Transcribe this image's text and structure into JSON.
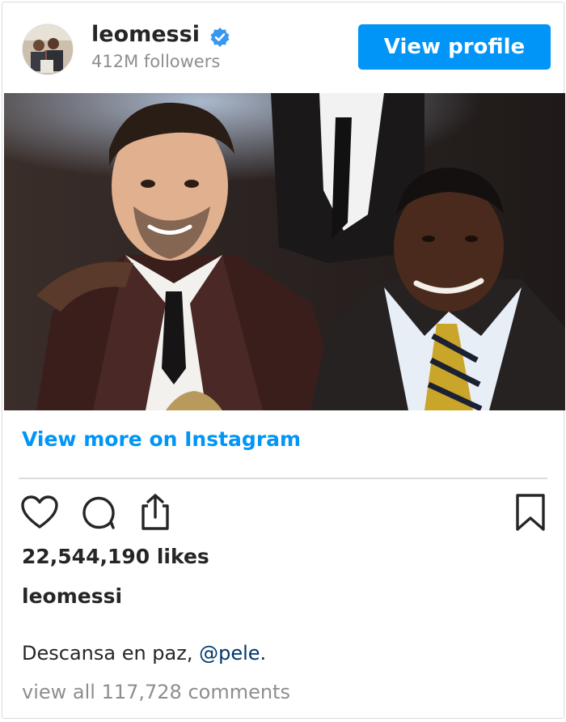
{
  "header": {
    "username": "leomessi",
    "verified_icon": "verified-badge-icon",
    "followers": "412M followers",
    "view_profile_label": "View profile"
  },
  "post": {
    "image_icon": "photo-messi-and-pele",
    "view_more_label": "View more on Instagram",
    "actions": [
      "heart-icon",
      "comment-icon",
      "share-icon",
      "bookmark-icon"
    ],
    "likes": "22,544,190 likes",
    "caption_user": "leomessi",
    "caption_text": "Descansa en paz, ",
    "caption_mention": "@pele",
    "caption_end": ".",
    "comments_link": "view all 117,728 comments"
  },
  "colors": {
    "accent": "#0095f6",
    "mention": "#00376b",
    "muted": "#8e8e8e",
    "text": "#262626"
  }
}
